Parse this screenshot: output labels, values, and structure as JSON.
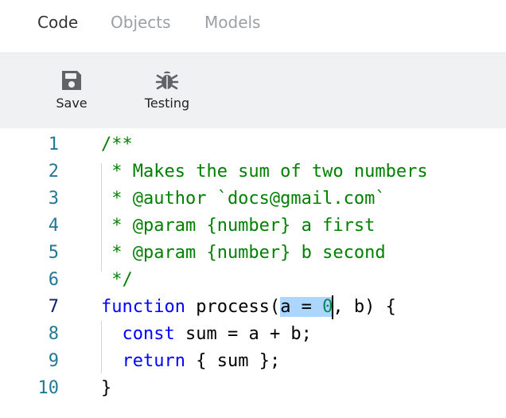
{
  "tabs": [
    {
      "label": "Code",
      "active": true
    },
    {
      "label": "Objects",
      "active": false
    },
    {
      "label": "Models",
      "active": false
    }
  ],
  "toolbar": {
    "save_label": "Save",
    "testing_label": "Testing",
    "save_icon": "save-icon",
    "testing_icon": "bug-icon"
  },
  "editor": {
    "line_numbers": [
      "1",
      "2",
      "3",
      "4",
      "5",
      "6",
      "7",
      "8",
      "9",
      "10"
    ],
    "active_line": 7,
    "lines": [
      [
        {
          "t": "/**",
          "c": "comment"
        }
      ],
      [
        {
          "t": " * Makes the sum of two numbers",
          "c": "comment"
        }
      ],
      [
        {
          "t": " * @author `docs@gmail.com`",
          "c": "comment"
        }
      ],
      [
        {
          "t": " * @param {number} a first",
          "c": "comment"
        }
      ],
      [
        {
          "t": " * @param {number} b second",
          "c": "comment"
        }
      ],
      [
        {
          "t": " */",
          "c": "comment"
        }
      ],
      [
        {
          "t": "function",
          "c": "kw"
        },
        {
          "t": " process(",
          "c": "plain"
        },
        {
          "t": "a = ",
          "c": "plain",
          "sel": true
        },
        {
          "t": "0",
          "c": "num",
          "sel": true
        },
        {
          "caret": true
        },
        {
          "t": ", b) {",
          "c": "plain"
        }
      ],
      [
        {
          "t": "  ",
          "c": "plain"
        },
        {
          "t": "const",
          "c": "kw"
        },
        {
          "t": " sum = a + b;",
          "c": "plain"
        }
      ],
      [
        {
          "t": "  ",
          "c": "plain"
        },
        {
          "t": "return",
          "c": "kw"
        },
        {
          "t": " { sum };",
          "c": "plain"
        }
      ],
      [
        {
          "t": "}",
          "c": "plain"
        }
      ]
    ]
  },
  "colors": {
    "comment": "#008000",
    "keyword": "#0000ff",
    "number": "#098658",
    "line_number": "#237893",
    "selection": "#add6ff",
    "toolbar_bg": "#f0f1f2"
  }
}
